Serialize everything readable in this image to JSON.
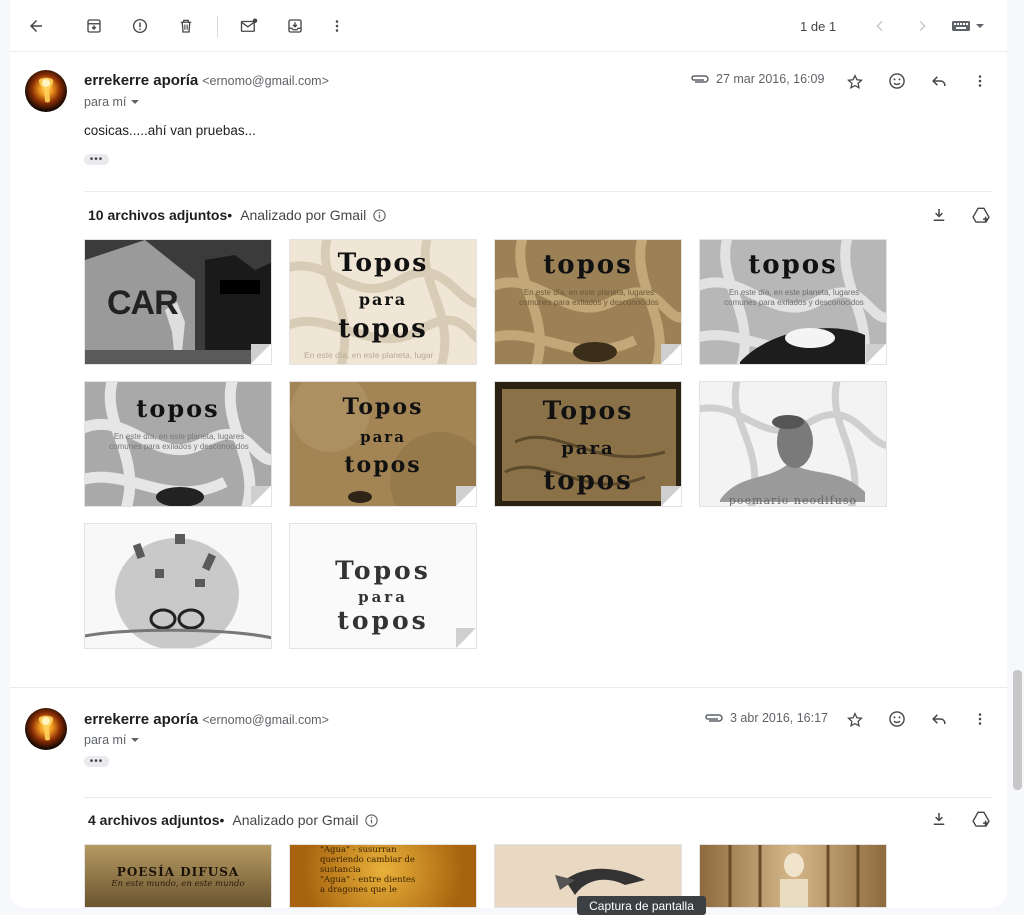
{
  "toolbar": {
    "pager_text": "1 de 1"
  },
  "messages": [
    {
      "sender_name": "errekerre aporía",
      "sender_email": "<ernomo@gmail.com>",
      "recipient": "para mí",
      "date": "27 mar 2016, 16:09",
      "body": "cosicas.....ahí van pruebas...",
      "attachments_title": "10 archivos adjuntos",
      "scanned_label": "Analizado por Gmail",
      "thumbnails": [
        {
          "kind": "street",
          "text": [
            "CAR"
          ]
        },
        {
          "kind": "topos-light",
          "text": [
            "Topos",
            "para",
            "topos",
            "En este día, en este planeta, lugar"
          ]
        },
        {
          "kind": "topos-brown",
          "text": [
            "topos",
            "En este día, en este planeta, lugares comunes para exilados y desconocidos"
          ]
        },
        {
          "kind": "topos-gray",
          "text": [
            "topos",
            "En este día, en este planeta, lugares comunes para exilados y desconocidos"
          ]
        },
        {
          "kind": "topos-gray2",
          "text": [
            "topos",
            "En este día, en este planeta, lugares comunes para exilados y desconocidos"
          ]
        },
        {
          "kind": "topos-tan",
          "text": [
            "Topos",
            "para",
            "topos"
          ]
        },
        {
          "kind": "topos-dark",
          "text": [
            "Topos",
            "para",
            "topos"
          ]
        },
        {
          "kind": "mole-sketch",
          "text": [
            "poemario neodifuso"
          ]
        },
        {
          "kind": "head-sketch",
          "text": []
        },
        {
          "kind": "topos-white",
          "text": [
            "Topos",
            "para",
            "topos"
          ]
        }
      ]
    },
    {
      "sender_name": "errekerre aporía",
      "sender_email": "<ernomo@gmail.com>",
      "recipient": "para mí",
      "date": "3 abr 2016, 16:17",
      "attachments_title": "4 archivos adjuntos",
      "scanned_label": "Analizado por Gmail",
      "thumbnails": [
        {
          "kind": "poesia",
          "text": [
            "POESÍA DIFUSA",
            "En este mundo, en este mundo"
          ]
        },
        {
          "kind": "orange",
          "text": [
            "\"Agua\" - susurran",
            "queriendo cambiar de",
            "sustancia",
            "\"Agua\" - entre dientes",
            "a dragones que le"
          ]
        },
        {
          "kind": "bird",
          "text": []
        },
        {
          "kind": "wood",
          "text": []
        }
      ]
    }
  ],
  "tooltip": "Captura de pantalla",
  "colors": {
    "background": "#f6f8fc",
    "card": "#ffffff",
    "icon": "#444746",
    "muted_text": "#5f6368"
  },
  "icons": [
    "back-arrow-icon",
    "archive-icon",
    "spam-icon",
    "trash-icon",
    "mark-unread-icon",
    "move-to-inbox-icon",
    "more-vert-icon",
    "chevron-left-icon",
    "chevron-right-icon",
    "keyboard-icon",
    "attachment-clip-icon",
    "star-icon",
    "emoji-icon",
    "reply-icon",
    "download-all-icon",
    "add-to-drive-icon",
    "info-icon"
  ]
}
